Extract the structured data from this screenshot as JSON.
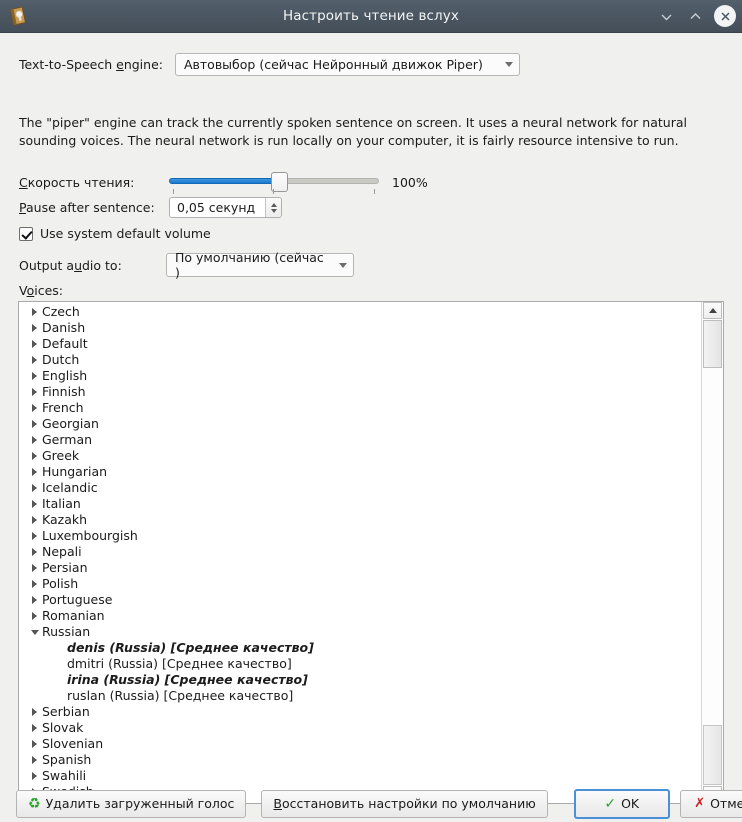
{
  "window": {
    "title": "Настроить чтение вслух",
    "icon": "book-speaker-icon",
    "minimize_label": "⌄",
    "maximize_label": "⌃",
    "close_label": "✕"
  },
  "engine": {
    "label_pre": "Text-to-Speech ",
    "label_accel": "e",
    "label_post": "ngine:",
    "value": "Автовыбор (сейчас Нейронный движок Piper)"
  },
  "description": "The \"piper\" engine can track the currently spoken sentence on screen. It uses a neural network for natural sounding voices. The neural network is run locally on your computer, it is fairly resource intensive to run.",
  "speed": {
    "label_accel": "С",
    "label_post": "корость чтения:",
    "value_text": "100%",
    "percent": 100,
    "fill_ratio": 0.52
  },
  "pause": {
    "label_accel": "P",
    "label_post": "ause after sentence:",
    "value": "0,05 секунд"
  },
  "volume": {
    "label": "Use system default volume",
    "checked": true
  },
  "output": {
    "label_pre": "Output a",
    "label_accel": "u",
    "label_post": "dio to:",
    "value": "По умолчанию (сейчас )"
  },
  "voices": {
    "label_pre": "V",
    "label_accel": "o",
    "label_post": "ices:",
    "items": [
      {
        "label": "Czech",
        "expanded": false,
        "level": 0
      },
      {
        "label": "Danish",
        "expanded": false,
        "level": 0
      },
      {
        "label": "Default",
        "expanded": false,
        "level": 0
      },
      {
        "label": "Dutch",
        "expanded": false,
        "level": 0
      },
      {
        "label": "English",
        "expanded": false,
        "level": 0
      },
      {
        "label": "Finnish",
        "expanded": false,
        "level": 0
      },
      {
        "label": "French",
        "expanded": false,
        "level": 0
      },
      {
        "label": "Georgian",
        "expanded": false,
        "level": 0
      },
      {
        "label": "German",
        "expanded": false,
        "level": 0
      },
      {
        "label": "Greek",
        "expanded": false,
        "level": 0
      },
      {
        "label": "Hungarian",
        "expanded": false,
        "level": 0
      },
      {
        "label": "Icelandic",
        "expanded": false,
        "level": 0
      },
      {
        "label": "Italian",
        "expanded": false,
        "level": 0
      },
      {
        "label": "Kazakh",
        "expanded": false,
        "level": 0
      },
      {
        "label": "Luxembourgish",
        "expanded": false,
        "level": 0
      },
      {
        "label": "Nepali",
        "expanded": false,
        "level": 0
      },
      {
        "label": "Persian",
        "expanded": false,
        "level": 0
      },
      {
        "label": "Polish",
        "expanded": false,
        "level": 0
      },
      {
        "label": "Portuguese",
        "expanded": false,
        "level": 0
      },
      {
        "label": "Romanian",
        "expanded": false,
        "level": 0
      },
      {
        "label": "Russian",
        "expanded": true,
        "level": 0
      },
      {
        "label": "denis (Russia) [Среднее качество]",
        "level": 1,
        "downloaded": true
      },
      {
        "label": "dmitri (Russia) [Среднее качество]",
        "level": 1,
        "downloaded": false
      },
      {
        "label": "irina (Russia) [Среднее качество]",
        "level": 1,
        "downloaded": true
      },
      {
        "label": "ruslan (Russia) [Среднее качество]",
        "level": 1,
        "downloaded": false
      },
      {
        "label": "Serbian",
        "expanded": false,
        "level": 0
      },
      {
        "label": "Slovak",
        "expanded": false,
        "level": 0
      },
      {
        "label": "Slovenian",
        "expanded": false,
        "level": 0
      },
      {
        "label": "Spanish",
        "expanded": false,
        "level": 0
      },
      {
        "label": "Swahili",
        "expanded": false,
        "level": 0
      },
      {
        "label": "Swedish",
        "expanded": false,
        "level": 0
      }
    ]
  },
  "buttons": {
    "delete_voice": "Удалить загруженный голос",
    "delete_voice_icon": "recycle-icon",
    "restore_accel": "В",
    "restore_post": "осстановить настройки по умолчанию",
    "ok": "OK",
    "ok_icon": "check-icon",
    "cancel": "Отменить",
    "cancel_icon": "cross-icon"
  },
  "colors": {
    "titlebar": "#4a5661",
    "slider_fill": "#1a7bd0",
    "focus_border": "#4a90d9",
    "ok_check": "#2f9e2f",
    "cancel_x": "#cc2222",
    "recycle_green": "#2aa32a"
  }
}
